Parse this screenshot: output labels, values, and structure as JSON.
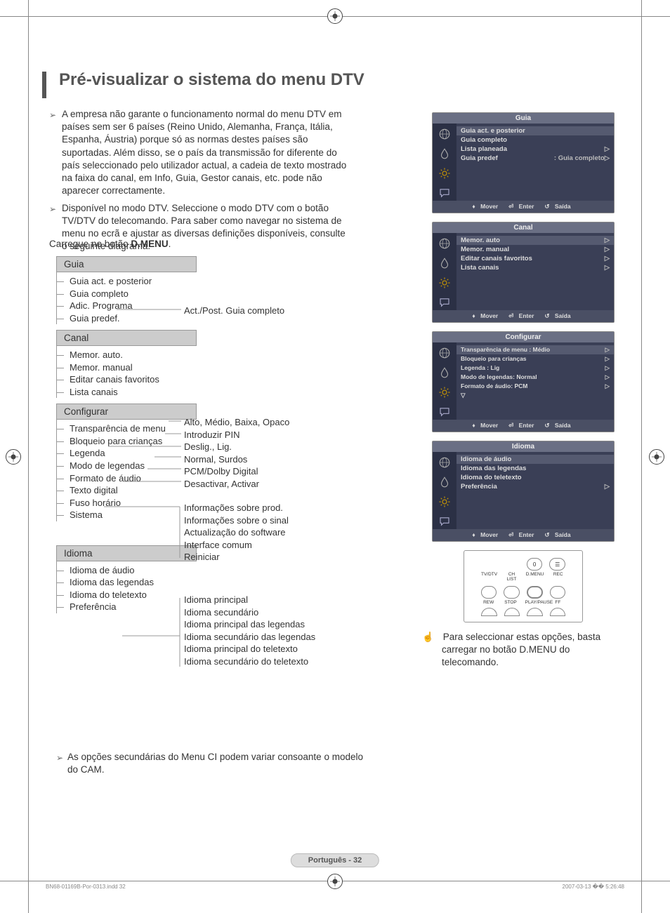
{
  "title": "Pré-visualizar o sistema do menu DTV",
  "intro": [
    "A empresa não garante o funcionamento normal do menu DTV em países sem ser 6 países (Reino Unido, Alemanha, França, Itália, Espanha, Áustria) porque só as normas destes países são suportadas. Além disso, se o país da transmissão for diferente do país seleccionado pelo utilizador actual, a cadeia de texto mostrado na faixa do canal, em Info, Guia, Gestor canais, etc. pode não aparecer correctamente.",
    "Disponível no modo DTV. Seleccione o modo DTV com o botão TV/DTV do telecomando. Para saber como navegar no sistema de menu no ecrã e ajustar as diversas definições disponíveis, consulte o seguinte diagrama."
  ],
  "press_prefix": "Carregue no botão ",
  "press_button": "D.MENU",
  "press_suffix": ".",
  "tree": {
    "guia": {
      "header": "Guia",
      "items": [
        "Guia act. e posterior",
        "Guia completo",
        "Adic. Programa",
        "Guia predef."
      ],
      "right": "Act./Post. Guia completo"
    },
    "canal": {
      "header": "Canal",
      "items": [
        "Memor. auto.",
        "Memor. manual",
        "Editar canais favoritos",
        "Lista canais"
      ]
    },
    "configurar": {
      "header": "Configurar",
      "items": [
        "Transparência de menu",
        "Bloqueio para crianças",
        "Legenda",
        "Modo de legendas",
        "Formato de áudio",
        "Texto digital",
        "Fuso horário",
        "Sistema"
      ],
      "right": [
        "Alto, Médio, Baixa, Opaco",
        "Introduzir PIN",
        "Deslig., Lig.",
        "Normal, Surdos",
        "PCM/Dolby Digital",
        "Desactivar, Activar",
        "",
        "Informações sobre prod.",
        "Informações sobre o sinal",
        "Actualização do software",
        "Interface comum",
        "Reiniciar"
      ]
    },
    "idioma": {
      "header": "Idioma",
      "items": [
        "Idioma de áudio",
        "Idioma das legendas",
        "Idioma do teletexto",
        "Preferência"
      ],
      "right": [
        "Idioma principal",
        "Idioma secundário",
        "Idioma principal das legendas",
        "Idioma secundário das legendas",
        "Idioma principal do teletexto",
        "Idioma secundário do teletexto"
      ]
    }
  },
  "osd": {
    "nav": {
      "mover": "Mover",
      "enter": "Enter",
      "saida": "Saída"
    },
    "guia": {
      "title": "Guia",
      "rows": [
        {
          "l": "Guia act. e posterior",
          "r": ""
        },
        {
          "l": "Guia completo",
          "r": ""
        },
        {
          "l": "Lista planeada",
          "r": "▷"
        },
        {
          "l": "Guia predef",
          "r": ": Guia completo▷"
        }
      ]
    },
    "canal": {
      "title": "Canal",
      "rows": [
        {
          "l": "Memor. auto",
          "r": "▷"
        },
        {
          "l": "Memor. manual",
          "r": "▷"
        },
        {
          "l": "Editar canais favoritos",
          "r": "▷"
        },
        {
          "l": "Lista canais",
          "r": "▷"
        }
      ]
    },
    "configurar": {
      "title": "Configurar",
      "rows": [
        {
          "l": "Transparência de menu : Médio",
          "r": "▷"
        },
        {
          "l": "Bloqueio para crianças",
          "r": "▷"
        },
        {
          "l": "Legenda                 : Lig",
          "r": "▷"
        },
        {
          "l": "Modo de legendas: Normal",
          "r": "▷"
        },
        {
          "l": "Formato de áudio: PCM",
          "r": "▷"
        },
        {
          "l": "▽",
          "r": ""
        }
      ]
    },
    "idioma": {
      "title": "Idioma",
      "rows": [
        {
          "l": "Idioma de áudio",
          "r": ""
        },
        {
          "l": "Idioma das legendas",
          "r": ""
        },
        {
          "l": "Idioma do teletexto",
          "r": ""
        },
        {
          "l": "Preferência",
          "r": "▷"
        }
      ]
    }
  },
  "remote": {
    "zero": "0",
    "labels1": [
      "TV/DTV",
      "CH LIST",
      "D.MENU",
      "REC"
    ],
    "labels2": [
      "REW",
      "STOP",
      "PLAY/PAUSE",
      "FF"
    ]
  },
  "note_right": "Para seleccionar estas opções, basta carregar no botão D.MENU do telecomando.",
  "bottom_note": "As opções secundárias do Menu CI podem variar consoante o modelo do CAM.",
  "page_number": "Português - 32",
  "footer_left": "BN68-01169B-Por-0313.indd   32",
  "footer_right": "2007-03-13   �� 5:26:48"
}
